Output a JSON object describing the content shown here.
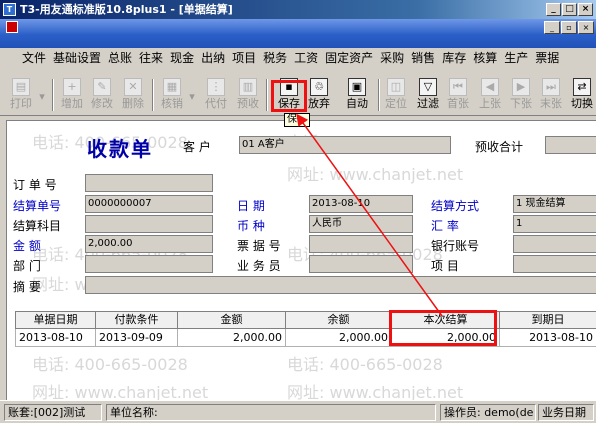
{
  "window": {
    "title": "T3-用友通标准版10.8plus1 - [单据结算]"
  },
  "menu": [
    "文件",
    "基础设置",
    "总账",
    "往来",
    "现金",
    "出纳",
    "项目",
    "税务",
    "工资",
    "固定资产",
    "采购",
    "销售",
    "库存",
    "核算",
    "生产",
    "票据"
  ],
  "toolbar": {
    "print": "打印",
    "add": "增加",
    "edit": "修改",
    "delete": "删除",
    "verify": "核销",
    "agent": "代付",
    "prepay": "预收",
    "save": "保存",
    "discard": "放弃",
    "auto": "自动",
    "locate": "定位",
    "filter": "过滤",
    "first": "首张",
    "prev": "上张",
    "next": "下张",
    "last": "末张",
    "switch": "切换"
  },
  "tooltip": "保",
  "form": {
    "title": "收款单",
    "customer_label": "客  户",
    "customer_value": "01  A客户",
    "prepay_total_label": "预收合计",
    "order_no_label": "订 单 号",
    "settle_no_label": "结算单号",
    "settle_no_value": "0000000007",
    "settle_item_label": "结算科目",
    "amount_label": "金  额",
    "amount_value": "2,000.00",
    "dept_label": "部  门",
    "summary_label": "摘  要",
    "date_label": "日  期",
    "date_value": "2013-08-10",
    "currency_label": "币  种",
    "currency_value": "人民币",
    "bill_no_label": "票 据 号",
    "clerk_label": "业 务 员",
    "settle_method_label": "结算方式",
    "settle_method_value": "1  现金结算",
    "rate_label": "汇  率",
    "rate_value": "1",
    "bank_account_label": "银行账号",
    "project_label": "项  目"
  },
  "grid": {
    "headers": [
      "单据日期",
      "付款条件",
      "金额",
      "余额",
      "本次结算",
      "到期日"
    ],
    "rows": [
      [
        "2013-08-10",
        "2013-09-09",
        "2,000.00",
        "2,000.00",
        "2,000.00",
        "2013-08-10"
      ]
    ]
  },
  "watermarks": [
    "电话: 400-665-0028",
    "网址: www.chanjet.net"
  ],
  "status": {
    "account": "账套:[002]测试",
    "unit": "单位名称:",
    "operator": "操作员: demo(de",
    "bizdate": "业务日期"
  },
  "colors": {
    "highlight": "#e11111",
    "title_blue": "#0000a8",
    "menubar": "#2b5fc7"
  }
}
